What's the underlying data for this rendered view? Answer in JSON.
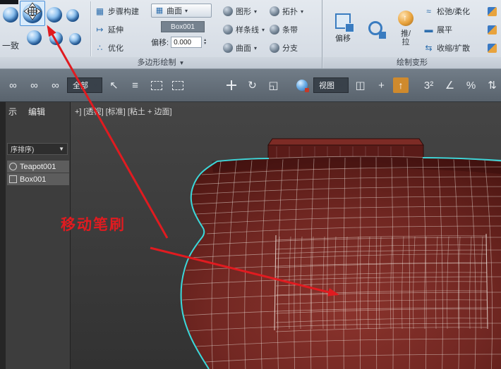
{
  "icons": {
    "caret_down": "▼",
    "small_caret": "▾",
    "spin_up": "▴",
    "spin_down": "▾",
    "link": "∞",
    "select_arrow": "↖",
    "select_by_name": "≡",
    "rotate": "↻",
    "scale": "◱",
    "pivot": "◫",
    "crosshair": "+",
    "up_arrow": "↑",
    "snap_3d": "3²",
    "angle_snap": "∠",
    "percent_snap": "%",
    "spinner_snap": "⇅",
    "step_build": "▦",
    "extend": "↦",
    "optimize": "∴",
    "surface_btn": "▦",
    "relax": "≈",
    "flatten": "▬",
    "pinch": "⇆"
  },
  "ribbon": {
    "conform": {
      "label": "一致"
    },
    "polydraw": {
      "panel_label": "多边形绘制",
      "step_build": "步骤构建",
      "extend": "延伸",
      "optimize": "优化",
      "surface_button": "曲面",
      "surface_object": "Box001",
      "offset_label": "偏移:",
      "offset_value": "0.000",
      "shapes": "图形",
      "splines": "样条线",
      "surface2": "曲面",
      "topology": "拓扑",
      "strips": "条带",
      "branches": "分支"
    },
    "paintdeform": {
      "panel_label": "绘制变形",
      "offset": "偏移",
      "push": "推/",
      "pull": "拉",
      "relax": "松弛/柔化",
      "flatten": "展平",
      "pinch": "收缩/扩散"
    }
  },
  "toolbar": {
    "selection_filter": "全部",
    "reference_coord": "视图"
  },
  "explorer": {
    "menu_display": "示",
    "menu_edit": "编辑",
    "sort_label": "序排序)",
    "items": [
      {
        "name": "Teapot001"
      },
      {
        "name": "Box001"
      }
    ]
  },
  "viewport": {
    "label": "+] [透视] [标准] [粘土 + 边面]"
  },
  "annotation": {
    "text": "移动笔刷"
  },
  "colors": {
    "selection_cyan": "#3ae1e4",
    "model_red": "#712722",
    "annotation_red": "#e01b20",
    "highlight_blue": "#4a90d9"
  }
}
